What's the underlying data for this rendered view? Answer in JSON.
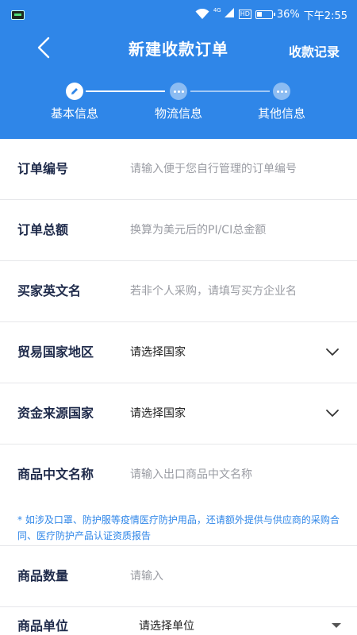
{
  "status_bar": {
    "network_label": "4G",
    "hd_label": "HD",
    "battery_percent": "36%",
    "time": "下午2:55"
  },
  "header": {
    "title": "新建收款订单",
    "records_link": "收款记录"
  },
  "stepper": {
    "steps": [
      {
        "label": "基本信息",
        "state": "active"
      },
      {
        "label": "物流信息",
        "state": "pending"
      },
      {
        "label": "其他信息",
        "state": "pending"
      }
    ]
  },
  "form": {
    "order_no": {
      "label": "订单编号",
      "placeholder": "请输入便于您自行管理的订单编号"
    },
    "order_total": {
      "label": "订单总额",
      "placeholder": "换算为美元后的PI/CI总金额"
    },
    "buyer_name": {
      "label": "买家英文名",
      "placeholder": "若非个人采购，请填写买方企业名"
    },
    "trade_country": {
      "label": "贸易国家地区",
      "value": "请选择国家"
    },
    "fund_country": {
      "label": "资金来源国家",
      "value": "请选择国家"
    },
    "product_cn_name": {
      "label": "商品中文名称",
      "placeholder": "请输入出口商品中文名称"
    },
    "notice": "* 如涉及口罩、防护服等疫情医疗防护用品，还请额外提供与供应商的采购合同、医疗防护产品认证资质报告",
    "quantity": {
      "label": "商品数量",
      "placeholder": "请输入"
    },
    "unit": {
      "label": "商品单位",
      "value": "请选择单位"
    }
  },
  "colors": {
    "brand_blue": "#2f86e8",
    "label_text": "#1e2a4a",
    "placeholder_text": "#9a9ca3"
  }
}
